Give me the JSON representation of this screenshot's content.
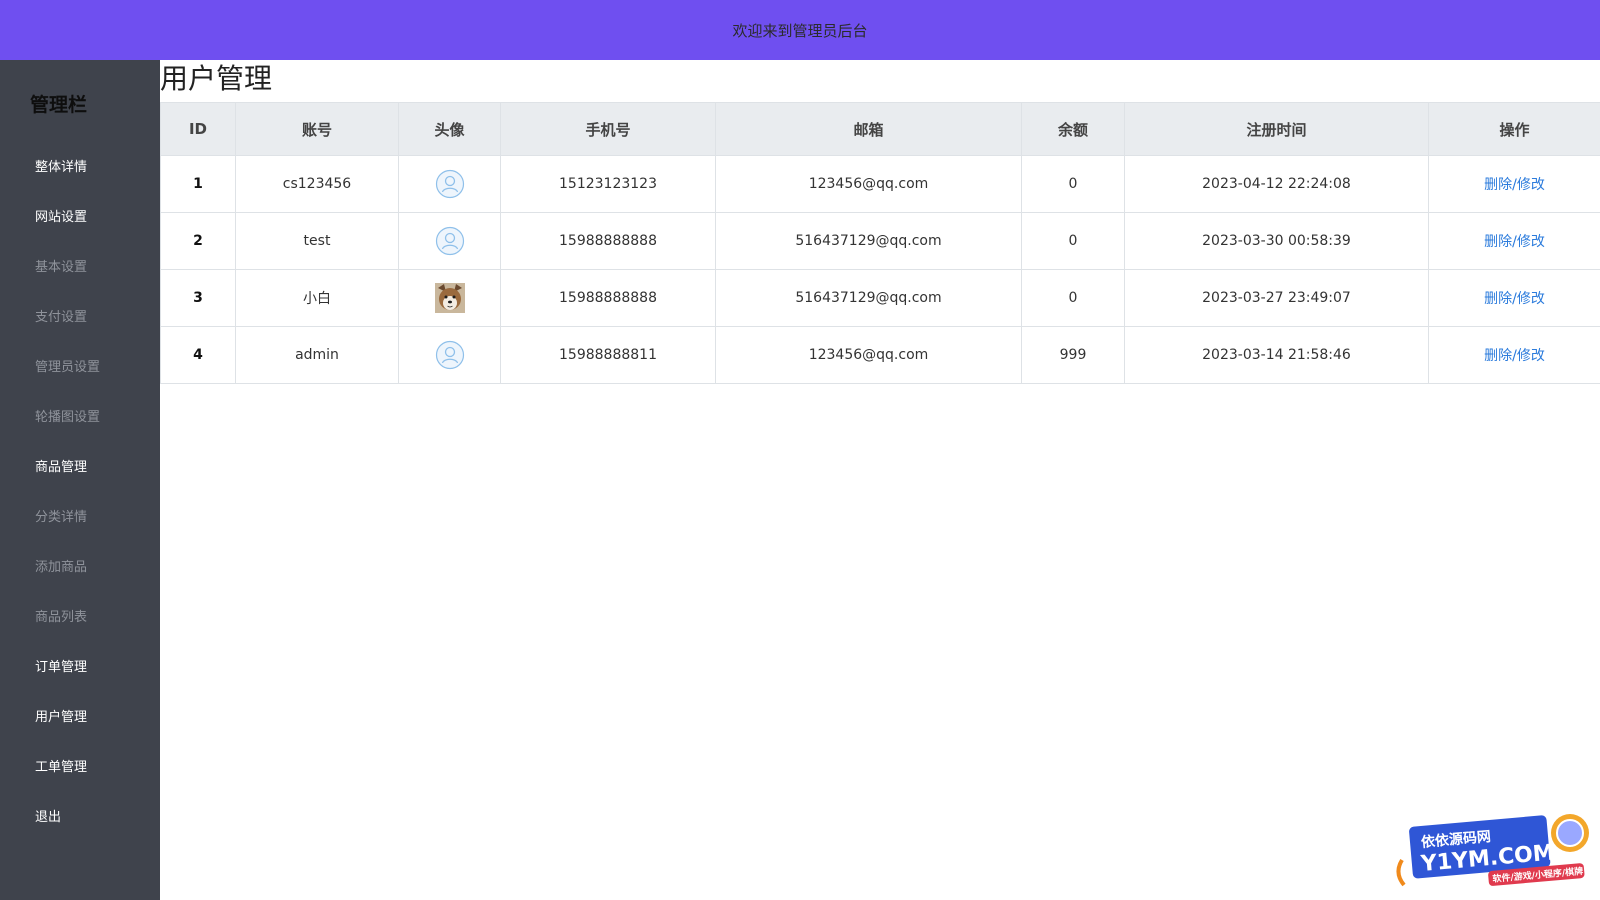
{
  "header": {
    "title": "欢迎来到管理员后台"
  },
  "sidebar": {
    "title": "管理栏",
    "items": [
      {
        "label": "整体详情",
        "type": "main"
      },
      {
        "label": "网站设置",
        "type": "main"
      },
      {
        "label": "基本设置",
        "type": "sub"
      },
      {
        "label": "支付设置",
        "type": "sub"
      },
      {
        "label": "管理员设置",
        "type": "sub"
      },
      {
        "label": "轮播图设置",
        "type": "sub"
      },
      {
        "label": "商品管理",
        "type": "main"
      },
      {
        "label": "分类详情",
        "type": "sub"
      },
      {
        "label": "添加商品",
        "type": "sub"
      },
      {
        "label": "商品列表",
        "type": "sub"
      },
      {
        "label": "订单管理",
        "type": "main"
      },
      {
        "label": "用户管理",
        "type": "main"
      },
      {
        "label": "工单管理",
        "type": "main"
      },
      {
        "label": "退出",
        "type": "main"
      }
    ]
  },
  "main": {
    "page_title": "用户管理",
    "table": {
      "headers": [
        "ID",
        "账号",
        "头像",
        "手机号",
        "邮箱",
        "余额",
        "注册时间",
        "操作"
      ],
      "rows": [
        {
          "id": "1",
          "account": "cs123456",
          "avatar": "default-avatar-icon",
          "phone": "15123123123",
          "email": "123456@qq.com",
          "balance": "0",
          "registered": "2023-04-12 22:24:08",
          "delete": "删除",
          "sep": "/",
          "edit": "修改"
        },
        {
          "id": "2",
          "account": "test",
          "avatar": "default-avatar-icon",
          "phone": "15988888888",
          "email": "516437129@qq.com",
          "balance": "0",
          "registered": "2023-03-30 00:58:39",
          "delete": "删除",
          "sep": "/",
          "edit": "修改"
        },
        {
          "id": "3",
          "account": "小白",
          "avatar": "dog-photo-avatar",
          "phone": "15988888888",
          "email": "516437129@qq.com",
          "balance": "0",
          "registered": "2023-03-27 23:49:07",
          "delete": "删除",
          "sep": "/",
          "edit": "修改"
        },
        {
          "id": "4",
          "account": "admin",
          "avatar": "default-avatar-icon",
          "phone": "15988888811",
          "email": "123456@qq.com",
          "balance": "999",
          "registered": "2023-03-14 21:58:46",
          "delete": "删除",
          "sep": "/",
          "edit": "修改"
        }
      ]
    }
  },
  "watermark": {
    "line1": "依依源码网",
    "line2": "Y1YM.COM",
    "line3": "软件/游戏/小程序/棋牌"
  },
  "colors": {
    "header_bg": "#6f4ff0",
    "sidebar_bg": "#3f434c",
    "link": "#2b7bdc"
  }
}
